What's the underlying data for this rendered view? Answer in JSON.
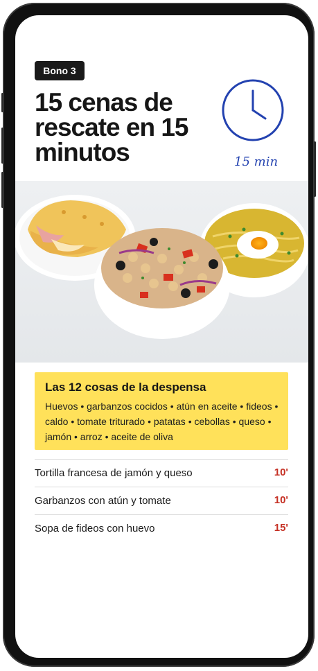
{
  "badge": "Bono 3",
  "title": "15 cenas de rescate en 15 minutos",
  "clock": {
    "label": "15 min",
    "icon": "clock-icon",
    "color": "#2342b0"
  },
  "photo": {
    "dishes": [
      "omelette",
      "chickpea-tuna-salad",
      "noodle-soup-with-egg"
    ]
  },
  "pantry": {
    "title": "Las 12 cosas de la despensa",
    "items": "Huevos • garbanzos cocidos • atún en aceite • fideos • caldo • tomate triturado • patatas • cebollas • queso • jamón • arroz • aceite de oliva",
    "background": "#ffe15a"
  },
  "recipes": [
    {
      "name": "Tortilla francesa de jamón y queso",
      "time": "10'"
    },
    {
      "name": "Garbanzos con atún y tomate",
      "time": "10'"
    },
    {
      "name": "Sopa de fideos con huevo",
      "time": "15'"
    }
  ],
  "colors": {
    "accent_time": "#c53024",
    "badge_bg": "#1a1a1a"
  }
}
